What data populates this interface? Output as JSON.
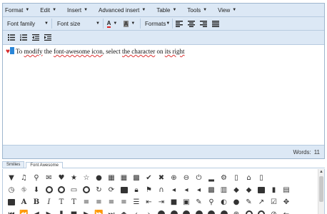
{
  "menubar": {
    "items": [
      "Format",
      "Edit",
      "Insert",
      "Advanced insert",
      "Table",
      "Tools",
      "View"
    ]
  },
  "toolbar": {
    "font_family": "Font family",
    "font_size": "Font size",
    "text_color_glyph": "A",
    "bg_color_glyph": "A",
    "formats": "Formats"
  },
  "content": {
    "text_before": "To ",
    "w1": "modify",
    "mid1": " the ",
    "w2": "font-awesome icon",
    "mid2": ", select ",
    "w3": "the character",
    "mid3": " on ",
    "w4": "its right"
  },
  "statusbar": {
    "words_label": "Words:",
    "words_count": "11"
  },
  "tabs": [
    "Smilies",
    "Font Awesome"
  ],
  "active_tab": "Font Awesome",
  "colors": {
    "accent": "#dce8f5",
    "border": "#9eb6ce",
    "heart": "#d62b2b",
    "selection": "#2a86d8"
  },
  "icon_rows": [
    [
      "filter",
      "music",
      "search",
      "envelope-o",
      "heart",
      "star",
      "star-o",
      "user",
      "film",
      "th-large",
      "th",
      "check",
      "times",
      "search-plus",
      "search-minus",
      "power-off",
      "signal",
      "cog",
      "trash-o",
      "home",
      "file-o"
    ],
    [
      "clock-o",
      "road",
      "download",
      "arrow-circle-o-down",
      "arrow-circle-o-up",
      "inbox",
      "play-circle-o",
      "repeat",
      "refresh",
      "list-alt",
      "lock",
      "flag",
      "headphones",
      "volume-off",
      "volume-down",
      "volume-up",
      "qrcode",
      "barcode",
      "tag",
      "tags",
      "book",
      "bookmark",
      "print"
    ],
    [
      "camera",
      "font",
      "bold",
      "italic",
      "text-height",
      "text-width",
      "align-left",
      "align-center",
      "align-right",
      "align-justify",
      "list",
      "outdent",
      "indent",
      "video-camera",
      "picture-o",
      "pencil",
      "map-marker",
      "adjust",
      "tint",
      "pencil-square-o",
      "share-square-o",
      "check-square-o",
      "arrows"
    ],
    [
      "step-backward",
      "fast-backward",
      "backward",
      "play",
      "pause",
      "stop",
      "forward",
      "fast-forward",
      "step-forward",
      "eject",
      "chevron-left",
      "chevron-right",
      "plus-circle",
      "minus-circle",
      "times-circle",
      "check-circle",
      "question-circle",
      "info-circle",
      "crosshairs",
      "times-circle-o",
      "check-circle-o",
      "ban",
      "arrow-left"
    ]
  ]
}
